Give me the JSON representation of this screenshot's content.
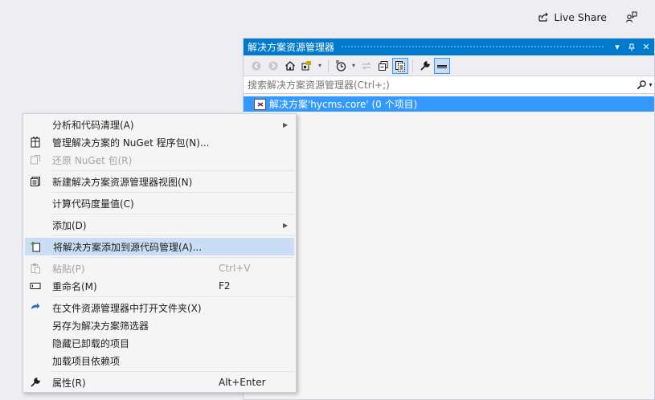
{
  "topbar": {
    "live_share_label": "Live Share",
    "feedback_icon": "feedback-icon"
  },
  "solution_explorer": {
    "title": "解决方案资源管理器",
    "search_placeholder": "搜索解决方案资源管理器(Ctrl+;)",
    "tree": {
      "solution_label": "解决方案'hycms.core' (0 个项目)"
    }
  },
  "context_menu": {
    "items": [
      {
        "label": "分析和代码清理(A)",
        "icon": "",
        "shortcut": "",
        "submenu": true
      },
      {
        "label": "管理解决方案的 NuGet 程序包(N)...",
        "icon": "nuget-icon",
        "shortcut": ""
      },
      {
        "label": "还原 NuGet 包(R)",
        "icon": "restore-icon",
        "shortcut": "",
        "disabled": true
      },
      {
        "label": "新建解决方案资源管理器视图(N)",
        "icon": "new-view-icon",
        "shortcut": ""
      },
      {
        "label": "计算代码度量值(C)",
        "icon": "",
        "shortcut": ""
      },
      {
        "label": "添加(D)",
        "icon": "",
        "shortcut": "",
        "submenu": true
      },
      {
        "label": "将解决方案添加到源代码管理(A)...",
        "icon": "add-source-control-icon",
        "shortcut": "",
        "highlighted": true
      },
      {
        "label": "粘贴(P)",
        "icon": "paste-icon",
        "shortcut": "Ctrl+V",
        "disabled": true
      },
      {
        "label": "重命名(M)",
        "icon": "rename-icon",
        "shortcut": "F2"
      },
      {
        "label": "在文件资源管理器中打开文件夹(X)",
        "icon": "open-folder-icon",
        "shortcut": ""
      },
      {
        "label": "另存为解决方案筛选器",
        "icon": "",
        "shortcut": ""
      },
      {
        "label": "隐藏已卸载的项目",
        "icon": "",
        "shortcut": ""
      },
      {
        "label": "加载项目依赖项",
        "icon": "",
        "shortcut": ""
      },
      {
        "label": "属性(R)",
        "icon": "wrench-icon",
        "shortcut": "Alt+Enter"
      }
    ]
  },
  "colors": {
    "accent": "#007acc",
    "selection": "#3399ff",
    "menu_highlight": "#c9def5"
  }
}
